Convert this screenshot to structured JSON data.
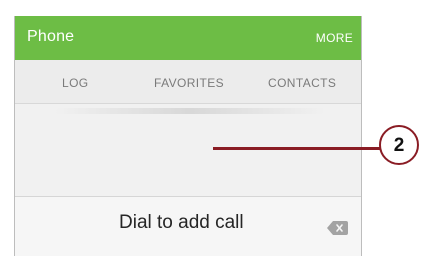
{
  "app_bar": {
    "title": "Phone",
    "more_label": "MORE"
  },
  "tabs": [
    {
      "label": "LOG"
    },
    {
      "label": "FAVORITES"
    },
    {
      "label": "CONTACTS"
    }
  ],
  "dial": {
    "prompt": "Dial to add call",
    "backspace_icon": "backspace-icon"
  },
  "callout": {
    "number": "2"
  },
  "colors": {
    "app_bar": "#6dbd45",
    "callout": "#8a1c24",
    "tab_text": "#7a7a7a"
  }
}
